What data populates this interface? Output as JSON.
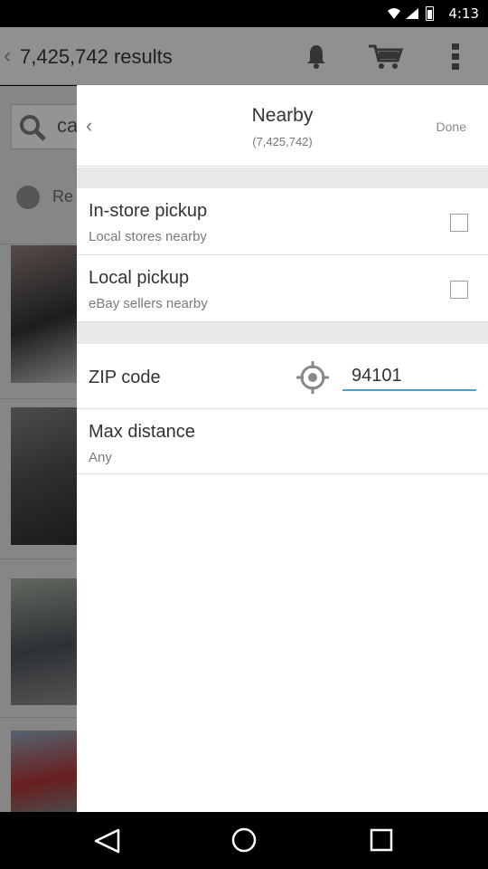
{
  "statusbar": {
    "time": "4:13"
  },
  "appbar": {
    "title": "7,425,742 results"
  },
  "background": {
    "search_text": "ca",
    "refine_text": "Re"
  },
  "panel": {
    "title": "Nearby",
    "count": "(7,425,742)",
    "done_label": "Done",
    "in_store": {
      "label": "In-store pickup",
      "sub": "Local stores nearby",
      "checked": false
    },
    "local": {
      "label": "Local pickup",
      "sub": "eBay sellers nearby",
      "checked": false
    },
    "zip": {
      "label": "ZIP code",
      "value": "94101"
    },
    "distance": {
      "label": "Max distance",
      "value": "Any"
    }
  },
  "colors": {
    "accent": "#3fa9d6"
  }
}
